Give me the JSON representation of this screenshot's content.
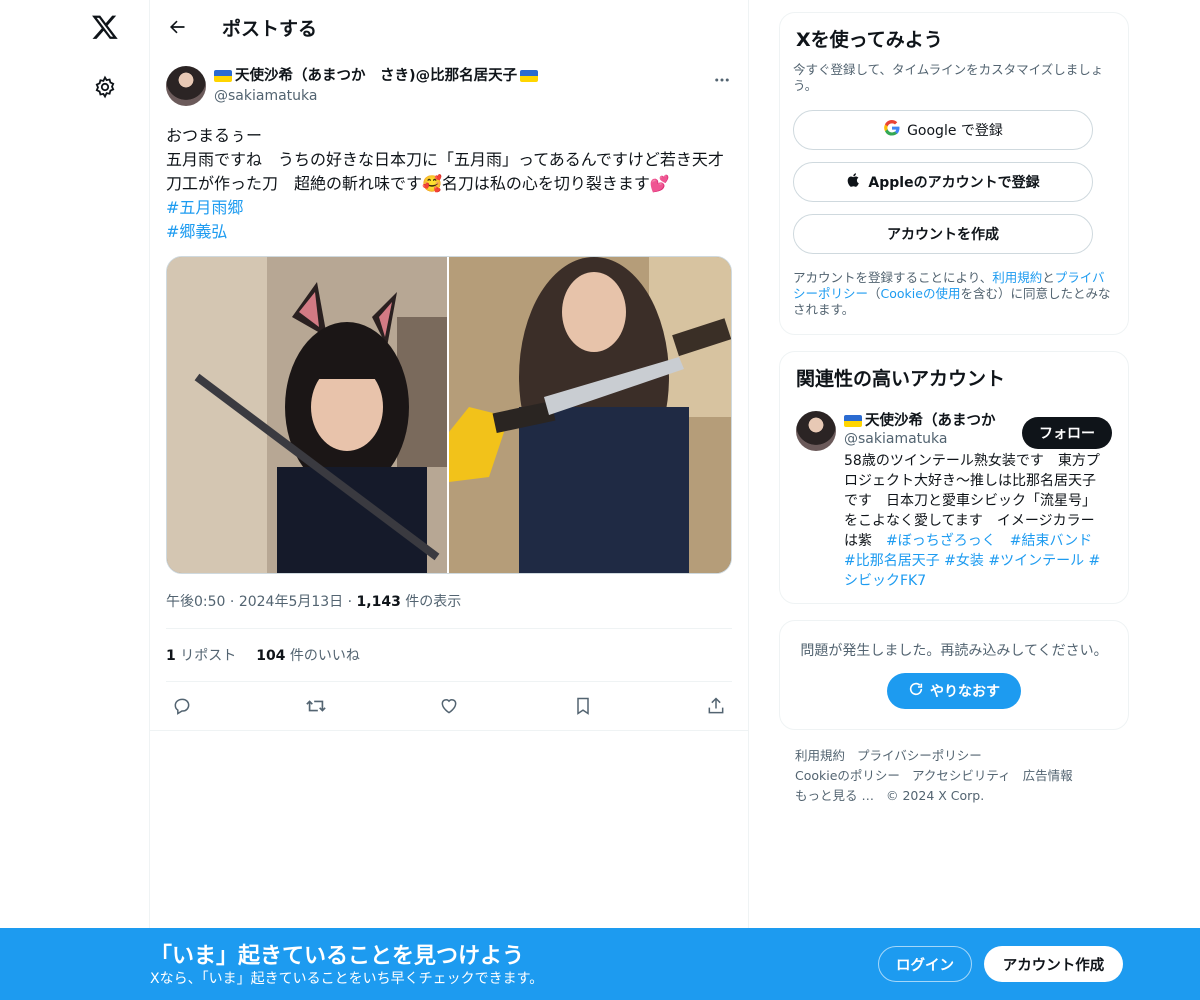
{
  "header": {
    "title": "ポストする"
  },
  "post": {
    "display_name": "天使沙希（あまつか　さき)@比那名居天子",
    "handle": "@sakiamatuka",
    "text": "おつまるぅー\n五月雨ですね　うちの好きな日本刀に「五月雨」ってあるんですけど若き天才刀工が作った刀　超絶の斬れ味です🥰名刀は私の心を切り裂きます💕",
    "hashtags": [
      "#五月雨郷",
      "#郷義弘"
    ],
    "time": "午後0:50",
    "date": "2024年5月13日",
    "views_count": "1,143",
    "views_label": "件の表示",
    "reposts_count": "1",
    "reposts_label": "リポスト",
    "likes_count": "104",
    "likes_label": "件のいいね"
  },
  "signup": {
    "title": "Xを使ってみよう",
    "subtitle": "今すぐ登録して、タイムラインをカスタマイズしましょう。",
    "google": "Google で登録",
    "apple": "Appleのアカウントで登録",
    "create": "アカウントを作成",
    "terms_1": "アカウントを登録することにより、",
    "terms_link1": "利用規約",
    "terms_2": "と",
    "terms_link2": "プライバシーポリシー",
    "terms_3": "（",
    "terms_link3": "Cookieの使用",
    "terms_4": "を含む）に同意したとみなされます。"
  },
  "related": {
    "title": "関連性の高いアカウント",
    "name": "天使沙希（あまつか",
    "handle": "@sakiamatuka",
    "follow": "フォロー",
    "bio_text": "58歳のツインテール熟女装です　東方プロジェクト大好き〜推しは比那名居天子です　日本刀と愛車シビック「流星号」をこよなく愛してます　イメージカラーは紫　",
    "bio_tags": "#ぼっちざろっく　#結束バンド　#比那名居天子 #女装 #ツインテール #シビックFK7"
  },
  "error": {
    "text": "問題が発生しました。再読み込みしてください。",
    "retry": "やりなおす"
  },
  "footer": {
    "links": [
      "利用規約",
      "プライバシーポリシー",
      "Cookieのポリシー",
      "アクセシビリティ",
      "広告情報",
      "もっと見る …",
      "© 2024 X Corp."
    ]
  },
  "bottombar": {
    "title": "「いま」起きていることを見つけよう",
    "subtitle": "Xなら、「いま」起きていることをいち早くチェックできます。",
    "login": "ログイン",
    "create": "アカウント作成"
  },
  "colors": {
    "accent": "#1d9bf0",
    "text": "#0f1419",
    "muted": "#536471"
  },
  "icons": [
    "x-logo-icon",
    "gear-icon",
    "back-arrow-icon",
    "more-icon",
    "reply-icon",
    "repost-icon",
    "like-icon",
    "bookmark-icon",
    "share-icon",
    "apple-icon",
    "refresh-icon"
  ]
}
